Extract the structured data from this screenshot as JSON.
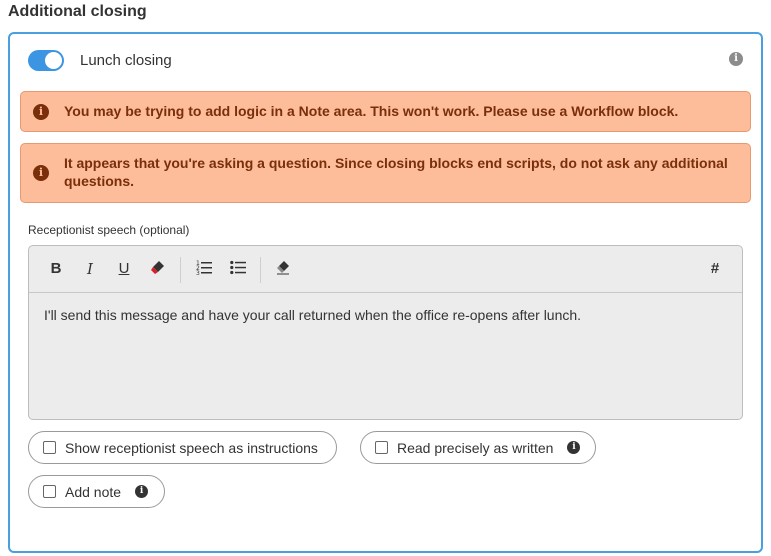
{
  "section": {
    "title": "Additional closing"
  },
  "lunch": {
    "toggle_label": "Lunch closing",
    "toggle_on": true,
    "info_icon": "i"
  },
  "alerts": [
    {
      "icon": "i",
      "text": "You may be trying to add logic in a Note area. This won't work. Please use a Workflow block."
    },
    {
      "icon": "i",
      "text": "It appears that you're asking a question. Since closing blocks end scripts, do not ask any additional questions."
    }
  ],
  "speech": {
    "label": "Receptionist speech (optional)",
    "toolbar": {
      "bold": "B",
      "italic": "I",
      "underline": "U",
      "color_icon": "marker-icon",
      "ordered_list_icon": "ordered-list-icon",
      "bullet_list_icon": "bullet-list-icon",
      "clear_format_icon": "eraser-icon",
      "variable": "#"
    },
    "text": "I'll send this message and have your call returned when the office re-opens after lunch."
  },
  "options": {
    "show_as_instructions": "Show receptionist speech as instructions",
    "read_precisely": "Read precisely as written",
    "add_note": "Add note",
    "info_icon": "i"
  },
  "colors": {
    "accent": "#3b95e3",
    "alert_bg": "#fdbd9a",
    "alert_text": "#7a2e0a",
    "alert_border": "#e79a70"
  }
}
